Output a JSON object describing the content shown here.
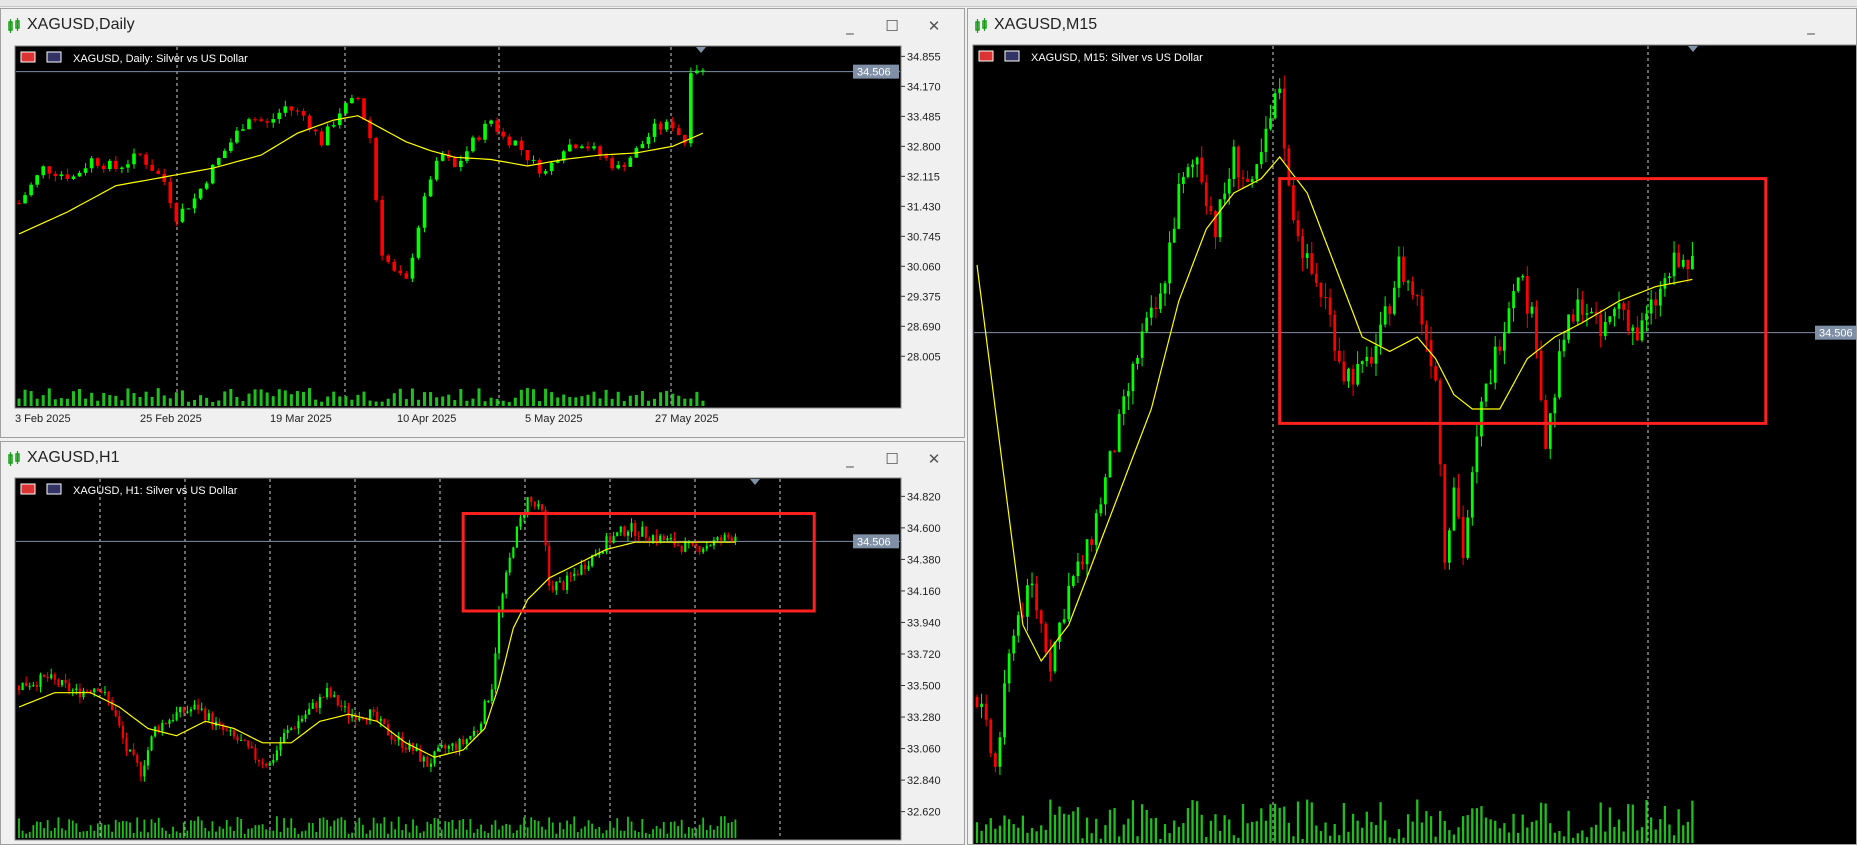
{
  "app": {
    "accent_green": "#00c800",
    "bull_color": "#00ff00",
    "bear_color": "#ff0000",
    "ma_color": "#ffff00",
    "box_color": "#ff2020",
    "background": "#000000"
  },
  "windows": [
    {
      "id": "daily",
      "title": "XAGUSD,Daily",
      "chart_label": "XAGUSD, Daily:  Silver vs US Dollar"
    },
    {
      "id": "h1",
      "title": "XAGUSD,H1",
      "chart_label": "XAGUSD, H1:  Silver vs US Dollar"
    },
    {
      "id": "m15",
      "title": "XAGUSD,M15",
      "chart_label": "XAGUSD, M15:  Silver vs US Dollar"
    }
  ],
  "window_controls": {
    "minimize": "_",
    "maximize": "☐",
    "close": "✕"
  },
  "chart_data": [
    {
      "type": "candlestick",
      "symbol": "XAGUSD",
      "timeframe": "Daily",
      "title": "XAGUSD, Daily:  Silver vs US Dollar",
      "ylim": [
        27.6,
        35.0
      ],
      "y_ticks": [
        "34.855",
        "34.170",
        "33.485",
        "32.800",
        "32.115",
        "31.430",
        "30.745",
        "30.060",
        "29.375",
        "28.690",
        "28.005"
      ],
      "x_ticks": [
        "3 Feb 2025",
        "25 Feb 2025",
        "19 Mar 2025",
        "10 Apr 2025",
        "5 May 2025",
        "27 May 2025"
      ],
      "current_price": "34.506",
      "grid": "vertical dotted",
      "moving_average": true,
      "close_path": [
        [
          0,
          31.5
        ],
        [
          4,
          32.3
        ],
        [
          9,
          32.1
        ],
        [
          12,
          32.5
        ],
        [
          16,
          32.3
        ],
        [
          20,
          32.6
        ],
        [
          24,
          32.0
        ],
        [
          26,
          31.2
        ],
        [
          29,
          31.6
        ],
        [
          32,
          32.3
        ],
        [
          35,
          32.9
        ],
        [
          38,
          33.5
        ],
        [
          41,
          33.3
        ],
        [
          44,
          33.7
        ],
        [
          47,
          33.5
        ],
        [
          50,
          32.9
        ],
        [
          53,
          33.6
        ],
        [
          56,
          33.9
        ],
        [
          58,
          33.0
        ],
        [
          59,
          31.6
        ],
        [
          60,
          30.4
        ],
        [
          62,
          29.9
        ],
        [
          64,
          29.7
        ],
        [
          66,
          31.0
        ],
        [
          68,
          32.1
        ],
        [
          70,
          32.6
        ],
        [
          72,
          32.3
        ],
        [
          75,
          32.9
        ],
        [
          78,
          33.4
        ],
        [
          80,
          33.0
        ],
        [
          82,
          32.9
        ],
        [
          85,
          32.4
        ],
        [
          87,
          32.2
        ],
        [
          90,
          32.8
        ],
        [
          93,
          32.9
        ],
        [
          96,
          32.6
        ],
        [
          99,
          32.3
        ],
        [
          102,
          32.7
        ],
        [
          105,
          33.2
        ],
        [
          108,
          33.3
        ],
        [
          110,
          32.9
        ],
        [
          111,
          34.6
        ],
        [
          112,
          34.6
        ],
        [
          113,
          34.5
        ]
      ],
      "ma_path": [
        [
          0,
          30.8
        ],
        [
          8,
          31.3
        ],
        [
          16,
          31.9
        ],
        [
          24,
          32.1
        ],
        [
          32,
          32.3
        ],
        [
          40,
          32.6
        ],
        [
          46,
          33.1
        ],
        [
          52,
          33.4
        ],
        [
          56,
          33.5
        ],
        [
          60,
          33.2
        ],
        [
          64,
          32.9
        ],
        [
          68,
          32.7
        ],
        [
          72,
          32.55
        ],
        [
          78,
          32.5
        ],
        [
          84,
          32.35
        ],
        [
          90,
          32.5
        ],
        [
          96,
          32.6
        ],
        [
          102,
          32.65
        ],
        [
          108,
          32.8
        ],
        [
          113,
          33.1
        ]
      ],
      "n_candles": 114
    },
    {
      "type": "candlestick",
      "symbol": "XAGUSD",
      "timeframe": "H1",
      "title": "XAGUSD, H1:  Silver vs US Dollar",
      "ylim": [
        32.45,
        34.92
      ],
      "y_ticks": [
        "34.820",
        "34.600",
        "34.380",
        "34.160",
        "33.940",
        "33.720",
        "33.500",
        "33.280",
        "33.060",
        "32.840",
        "32.620"
      ],
      "current_price": "34.506",
      "grid": "vertical dotted",
      "moving_average": true,
      "close_path": [
        [
          0,
          33.5
        ],
        [
          8,
          33.55
        ],
        [
          16,
          33.45
        ],
        [
          22,
          33.5
        ],
        [
          26,
          33.35
        ],
        [
          30,
          33.05
        ],
        [
          34,
          32.9
        ],
        [
          38,
          33.2
        ],
        [
          44,
          33.3
        ],
        [
          50,
          33.35
        ],
        [
          56,
          33.2
        ],
        [
          62,
          33.1
        ],
        [
          66,
          33.0
        ],
        [
          70,
          32.95
        ],
        [
          74,
          33.15
        ],
        [
          80,
          33.3
        ],
        [
          86,
          33.45
        ],
        [
          92,
          33.3
        ],
        [
          98,
          33.3
        ],
        [
          104,
          33.15
        ],
        [
          110,
          33.05
        ],
        [
          114,
          32.95
        ],
        [
          118,
          33.05
        ],
        [
          124,
          33.1
        ],
        [
          128,
          33.2
        ],
        [
          132,
          33.5
        ],
        [
          134,
          34.0
        ],
        [
          138,
          34.5
        ],
        [
          142,
          34.8
        ],
        [
          146,
          34.7
        ],
        [
          148,
          34.2
        ],
        [
          152,
          34.2
        ],
        [
          158,
          34.35
        ],
        [
          164,
          34.5
        ],
        [
          170,
          34.6
        ],
        [
          176,
          34.55
        ],
        [
          182,
          34.5
        ],
        [
          188,
          34.45
        ],
        [
          194,
          34.5
        ],
        [
          200,
          34.55
        ]
      ],
      "ma_path": [
        [
          0,
          33.35
        ],
        [
          10,
          33.45
        ],
        [
          20,
          33.45
        ],
        [
          28,
          33.35
        ],
        [
          36,
          33.2
        ],
        [
          44,
          33.15
        ],
        [
          52,
          33.25
        ],
        [
          60,
          33.2
        ],
        [
          68,
          33.1
        ],
        [
          76,
          33.1
        ],
        [
          84,
          33.25
        ],
        [
          92,
          33.3
        ],
        [
          100,
          33.25
        ],
        [
          108,
          33.1
        ],
        [
          116,
          33.0
        ],
        [
          124,
          33.05
        ],
        [
          130,
          33.2
        ],
        [
          134,
          33.5
        ],
        [
          138,
          33.9
        ],
        [
          142,
          34.1
        ],
        [
          148,
          34.25
        ],
        [
          156,
          34.35
        ],
        [
          164,
          34.45
        ],
        [
          172,
          34.5
        ],
        [
          180,
          34.5
        ],
        [
          190,
          34.5
        ],
        [
          200,
          34.5
        ]
      ],
      "n_candles": 201,
      "box": {
        "x0": 124,
        "x1": 222,
        "y_top": 34.7,
        "y_bottom": 34.02
      }
    },
    {
      "type": "candlestick",
      "symbol": "XAGUSD",
      "timeframe": "M15",
      "title": "XAGUSD, M15:  Silver vs US Dollar",
      "ylim": [
        33.8,
        34.9
      ],
      "current_price": "34.506",
      "grid": "vertical dotted",
      "moving_average": true,
      "close_path": [
        [
          0,
          34.0
        ],
        [
          4,
          33.9
        ],
        [
          8,
          34.1
        ],
        [
          12,
          34.15
        ],
        [
          16,
          34.05
        ],
        [
          20,
          34.15
        ],
        [
          24,
          34.2
        ],
        [
          28,
          34.3
        ],
        [
          32,
          34.4
        ],
        [
          36,
          34.5
        ],
        [
          40,
          34.55
        ],
        [
          44,
          34.7
        ],
        [
          48,
          34.75
        ],
        [
          52,
          34.65
        ],
        [
          56,
          34.75
        ],
        [
          60,
          34.7
        ],
        [
          64,
          34.8
        ],
        [
          66,
          34.85
        ],
        [
          68,
          34.7
        ],
        [
          72,
          34.6
        ],
        [
          76,
          34.55
        ],
        [
          80,
          34.45
        ],
        [
          84,
          34.45
        ],
        [
          88,
          34.5
        ],
        [
          92,
          34.6
        ],
        [
          96,
          34.55
        ],
        [
          100,
          34.45
        ],
        [
          102,
          34.2
        ],
        [
          104,
          34.3
        ],
        [
          106,
          34.2
        ],
        [
          110,
          34.4
        ],
        [
          114,
          34.5
        ],
        [
          118,
          34.6
        ],
        [
          122,
          34.5
        ],
        [
          124,
          34.35
        ],
        [
          128,
          34.5
        ],
        [
          132,
          34.55
        ],
        [
          136,
          34.5
        ],
        [
          140,
          34.55
        ],
        [
          144,
          34.5
        ],
        [
          148,
          34.55
        ],
        [
          152,
          34.6
        ],
        [
          156,
          34.6
        ]
      ],
      "ma_path": [
        [
          0,
          34.6
        ],
        [
          6,
          34.3
        ],
        [
          10,
          34.1
        ],
        [
          14,
          34.05
        ],
        [
          20,
          34.1
        ],
        [
          26,
          34.2
        ],
        [
          32,
          34.3
        ],
        [
          38,
          34.4
        ],
        [
          44,
          34.55
        ],
        [
          50,
          34.65
        ],
        [
          56,
          34.7
        ],
        [
          62,
          34.72
        ],
        [
          66,
          34.75
        ],
        [
          72,
          34.7
        ],
        [
          78,
          34.6
        ],
        [
          84,
          34.5
        ],
        [
          90,
          34.48
        ],
        [
          96,
          34.5
        ],
        [
          100,
          34.47
        ],
        [
          104,
          34.42
        ],
        [
          108,
          34.4
        ],
        [
          114,
          34.4
        ],
        [
          120,
          34.47
        ],
        [
          126,
          34.5
        ],
        [
          132,
          34.52
        ],
        [
          140,
          34.55
        ],
        [
          148,
          34.57
        ],
        [
          156,
          34.58
        ]
      ],
      "n_candles": 157,
      "box": {
        "x0": 66,
        "x1": 172,
        "y_top": 34.72,
        "y_bottom": 34.38
      }
    }
  ]
}
